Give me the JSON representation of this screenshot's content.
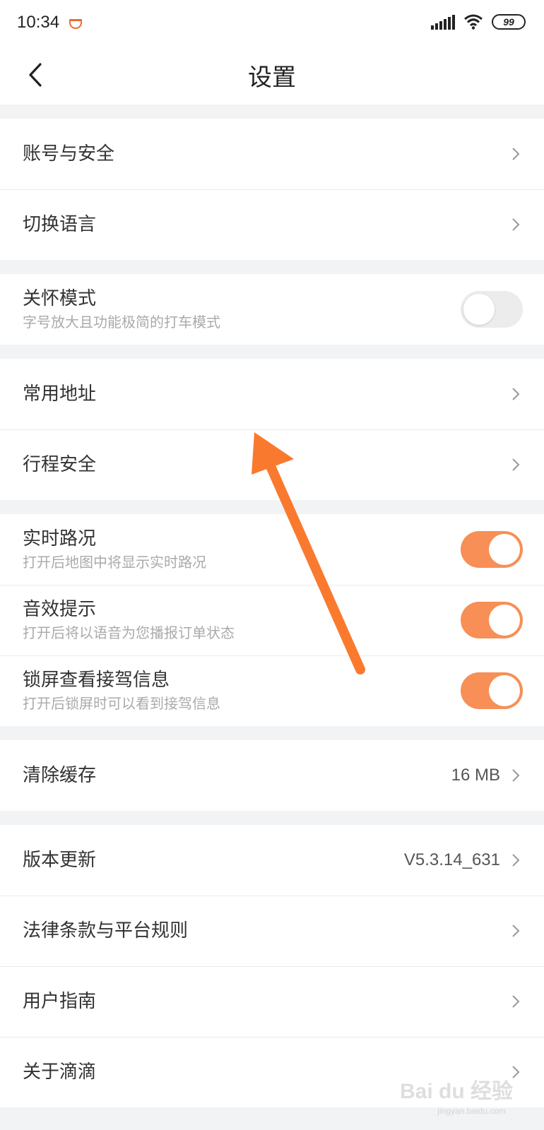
{
  "status": {
    "time": "10:34",
    "battery": "99"
  },
  "header": {
    "title": "设置"
  },
  "groups": {
    "account": [
      {
        "label": "账号与安全"
      },
      {
        "label": "切换语言"
      }
    ],
    "care": {
      "label": "关怀模式",
      "sub": "字号放大且功能极简的打车模式",
      "enabled": false
    },
    "places": [
      {
        "label": "常用地址"
      },
      {
        "label": "行程安全"
      }
    ],
    "toggles": [
      {
        "label": "实时路况",
        "sub": "打开后地图中将显示实时路况",
        "enabled": true
      },
      {
        "label": "音效提示",
        "sub": "打开后将以语音为您播报订单状态",
        "enabled": true
      },
      {
        "label": "锁屏查看接驾信息",
        "sub": "打开后锁屏时可以看到接驾信息",
        "enabled": true
      }
    ],
    "cache": {
      "label": "清除缓存",
      "value": "16 MB"
    },
    "about": [
      {
        "label": "版本更新",
        "value": "V5.3.14_631"
      },
      {
        "label": "法律条款与平台规则"
      },
      {
        "label": "用户指南"
      },
      {
        "label": "关于滴滴"
      }
    ]
  },
  "watermark": {
    "text": "Bai du 经验",
    "sub": "jingyan.baidu.com"
  },
  "colors": {
    "accent": "#f78f56",
    "arrow": "#f97a2f",
    "background": "#f2f3f5"
  }
}
